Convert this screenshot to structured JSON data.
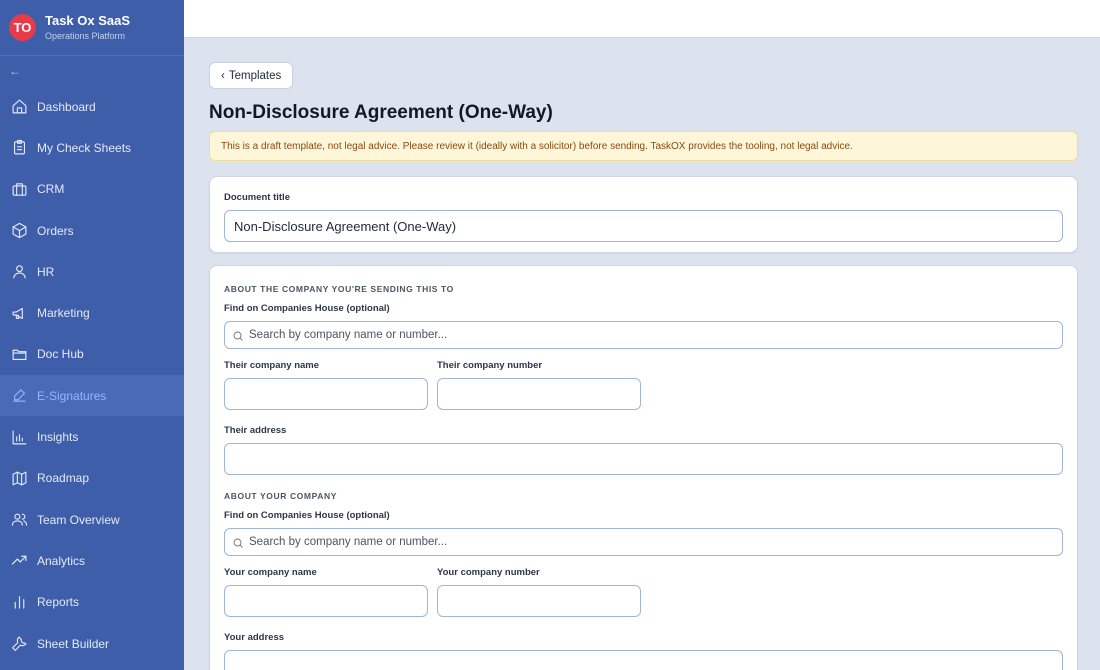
{
  "brand": {
    "initials": "TO",
    "name": "Task Ox SaaS",
    "subtitle": "Operations Platform",
    "collapse_glyph": "←"
  },
  "nav": [
    {
      "label": "Dashboard",
      "icon": "home-icon"
    },
    {
      "label": "My Check Sheets",
      "icon": "clipboard-icon"
    },
    {
      "label": "CRM",
      "icon": "briefcase-icon"
    },
    {
      "label": "Orders",
      "icon": "box-icon"
    },
    {
      "label": "HR",
      "icon": "user-icon"
    },
    {
      "label": "Marketing",
      "icon": "megaphone-icon"
    },
    {
      "label": "Doc Hub",
      "icon": "folder-icon"
    },
    {
      "label": "E-Signatures",
      "icon": "pen-icon",
      "active": true
    },
    {
      "label": "Insights",
      "icon": "bar-chart-icon"
    },
    {
      "label": "Roadmap",
      "icon": "map-icon"
    },
    {
      "label": "Team Overview",
      "icon": "users-icon"
    },
    {
      "label": "Analytics",
      "icon": "trending-up-icon"
    },
    {
      "label": "Reports",
      "icon": "bar-chart-2-icon"
    },
    {
      "label": "Sheet Builder",
      "icon": "wrench-icon"
    }
  ],
  "colors": {
    "sidebar": "#3f5ea9",
    "accent": "#8fb8ff",
    "notice_bg": "#fdf6d9",
    "notice_text": "#8a4a12",
    "avatar": "#e63b4a"
  },
  "page": {
    "back_label": "Templates",
    "back_glyph": "‹",
    "title": "Non-Disclosure Agreement (One-Way)",
    "notice": "This is a draft template, not legal advice. Please review it (ideally with a solicitor) before sending. TaskOX provides the tooling, not legal advice."
  },
  "title_card": {
    "label": "Document title",
    "value": "Non-Disclosure Agreement (One-Way)"
  },
  "recipient": {
    "section": "ABOUT THE COMPANY YOU'RE SENDING THIS TO",
    "find_label": "Find on Companies House (optional)",
    "search_placeholder": "Search by company name or number...",
    "name_label": "Their company name",
    "number_label": "Their company number",
    "address_label": "Their address",
    "name_value": "",
    "number_value": "",
    "address_value": ""
  },
  "sender": {
    "section": "ABOUT YOUR COMPANY",
    "find_label": "Find on Companies House (optional)",
    "search_placeholder": "Search by company name or number...",
    "name_label": "Your company name",
    "number_label": "Your company number",
    "address_label": "Your address",
    "name_value": "",
    "number_value": "",
    "address_value": ""
  }
}
